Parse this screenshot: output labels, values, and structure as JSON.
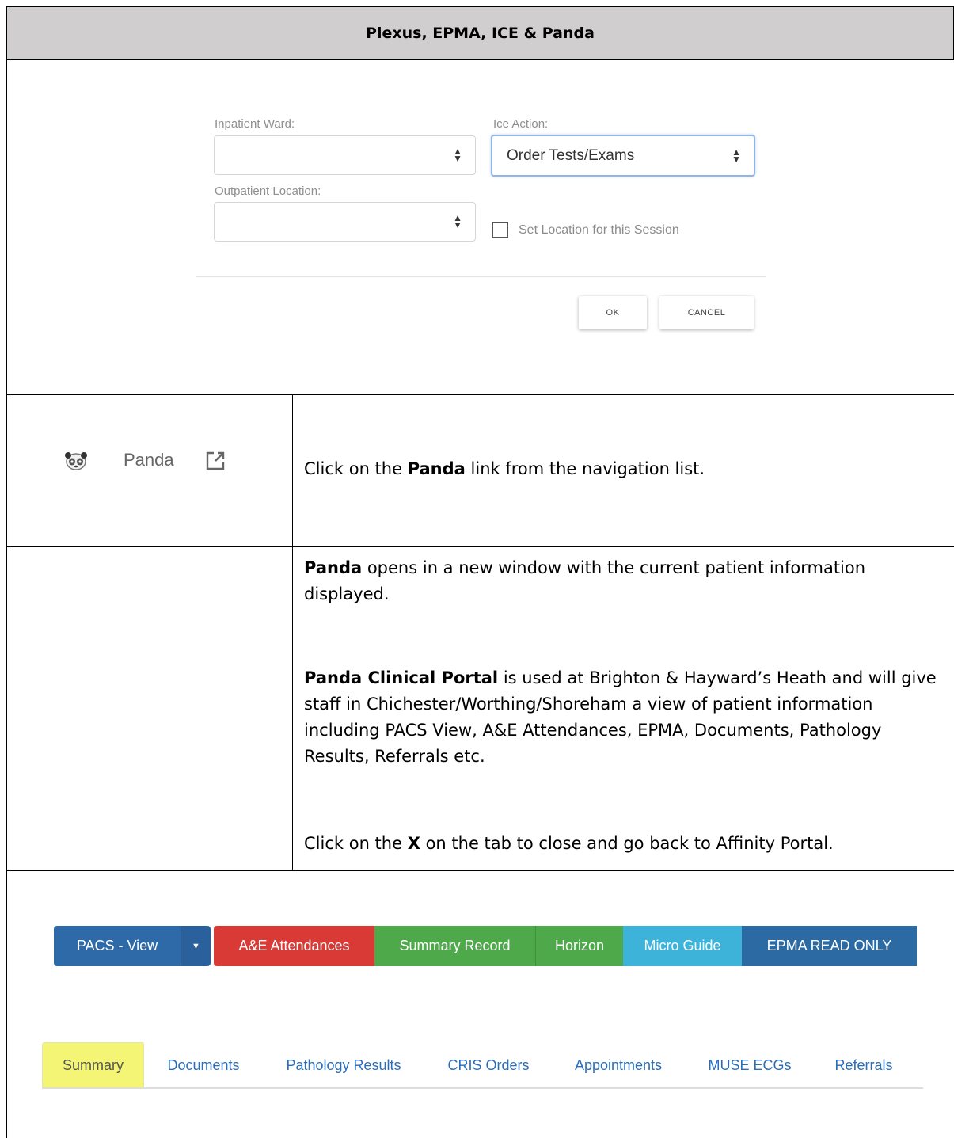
{
  "header": {
    "title": "Plexus, EPMA, ICE & Panda"
  },
  "dialog": {
    "inpatient_label": "Inpatient Ward:",
    "inpatient_value": "",
    "ice_label": "Ice Action:",
    "ice_value": "Order Tests/Exams",
    "outpatient_label": "Outpatient Location:",
    "outpatient_value": "",
    "checkbox_label": "Set Location for this Session",
    "ok_label": "OK",
    "cancel_label": "CANCEL"
  },
  "panda_row": {
    "link_label": "Panda",
    "instruction_prefix": "Click on the ",
    "instruction_bold": "Panda",
    "instruction_suffix": " link from the navigation list."
  },
  "info_row": {
    "p1_bold": "Panda",
    "p1_rest": " opens in a new window with the current patient information displayed.",
    "p2_bold": "Panda Clinical Portal",
    "p2_rest": " is used at Brighton & Hayward’s Heath and will give staff in Chichester/Worthing/Shoreham a view of patient information including PACS View, A&E Attendances, EPMA, Documents, Pathology Results, Referrals etc.",
    "p3_prefix": "Click on the ",
    "p3_bold": "X",
    "p3_suffix": " on the tab to close and go back to Affinity Portal."
  },
  "toolbar": {
    "pacs": "PACS - View",
    "ae": "A&E Attendances",
    "summary_record": "Summary Record",
    "horizon": "Horizon",
    "micro_guide": "Micro Guide",
    "epma": "EPMA READ ONLY",
    "colors": {
      "pacs": "#2f6aa8",
      "ae": "#d93a35",
      "summary": "#4ea94a",
      "horizon": "#4ea94a",
      "micro": "#3eb3da",
      "epma": "#2c6aa4"
    }
  },
  "tabs": [
    "Summary",
    "Documents",
    "Pathology Results",
    "CRIS Orders",
    "Appointments",
    "MUSE ECGs",
    "Referrals"
  ]
}
